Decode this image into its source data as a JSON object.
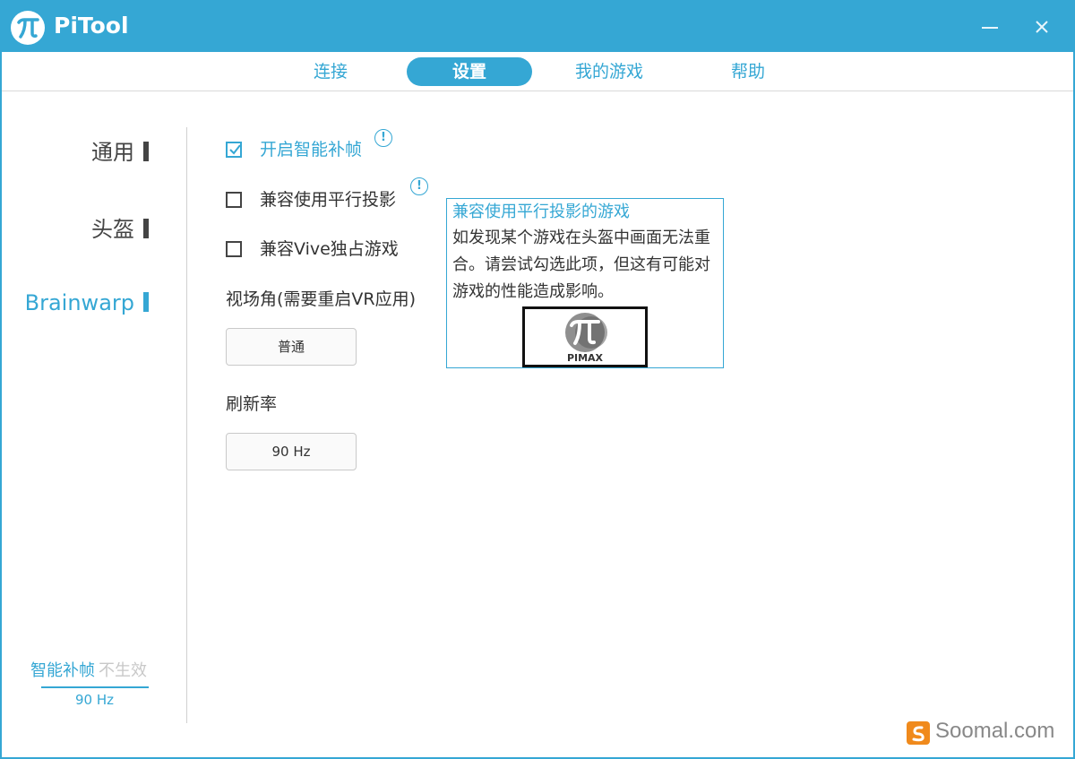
{
  "window": {
    "title": "PiTool",
    "brand_color": "#35a7d4"
  },
  "tabs": [
    {
      "label": "连接",
      "active": false
    },
    {
      "label": "设置",
      "active": true
    },
    {
      "label": "我的游戏",
      "active": false
    },
    {
      "label": "帮助",
      "active": false
    }
  ],
  "sidebar": {
    "items": [
      {
        "label": "通用",
        "active": false
      },
      {
        "label": "头盔",
        "active": false
      },
      {
        "label": "Brainwarp",
        "active": true
      }
    ],
    "status": {
      "feature": "智能补帧",
      "state": "不生效",
      "refresh": "90 Hz"
    }
  },
  "settings": {
    "options": [
      {
        "label": "开启智能补帧",
        "checked": true,
        "icon": "info-icon"
      },
      {
        "label": "兼容使用平行投影",
        "checked": false,
        "icon": "info-icon"
      },
      {
        "label": "兼容Vive独占游戏",
        "checked": false
      }
    ],
    "fov_label": "视场角(需要重启VR应用)",
    "fov_value": "普通",
    "refresh_label": "刷新率",
    "refresh_value": "90 Hz"
  },
  "tooltip": {
    "title": "兼容使用平行投影的游戏",
    "body": "如发现某个游戏在头盔中画面无法重合。请尝试勾选此项，但这有可能对游戏的性能造成影响。",
    "logo": "PIMAX"
  },
  "watermark": {
    "text": "Soomal.com"
  }
}
